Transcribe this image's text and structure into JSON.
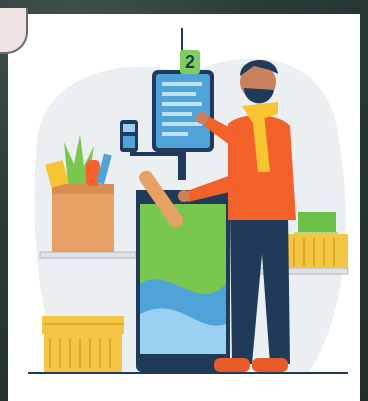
{
  "scene": {
    "checkout_number": "2",
    "colors": {
      "background_blob": "#eceff1",
      "kiosk_green": "#7ac74f",
      "kiosk_blue": "#4fa3d8",
      "screen_blue": "#3a7bd5",
      "person_jacket": "#f2612a",
      "scarf": "#f7c531",
      "pants": "#203a5a",
      "shoes": "#e85a28",
      "bag_brown": "#e8a165",
      "basket_yellow": "#f4c542",
      "package_green": "#6cc04a"
    },
    "icons": [
      "card-reader-icon",
      "shopping-basket-icon",
      "paper-bag-icon"
    ]
  }
}
